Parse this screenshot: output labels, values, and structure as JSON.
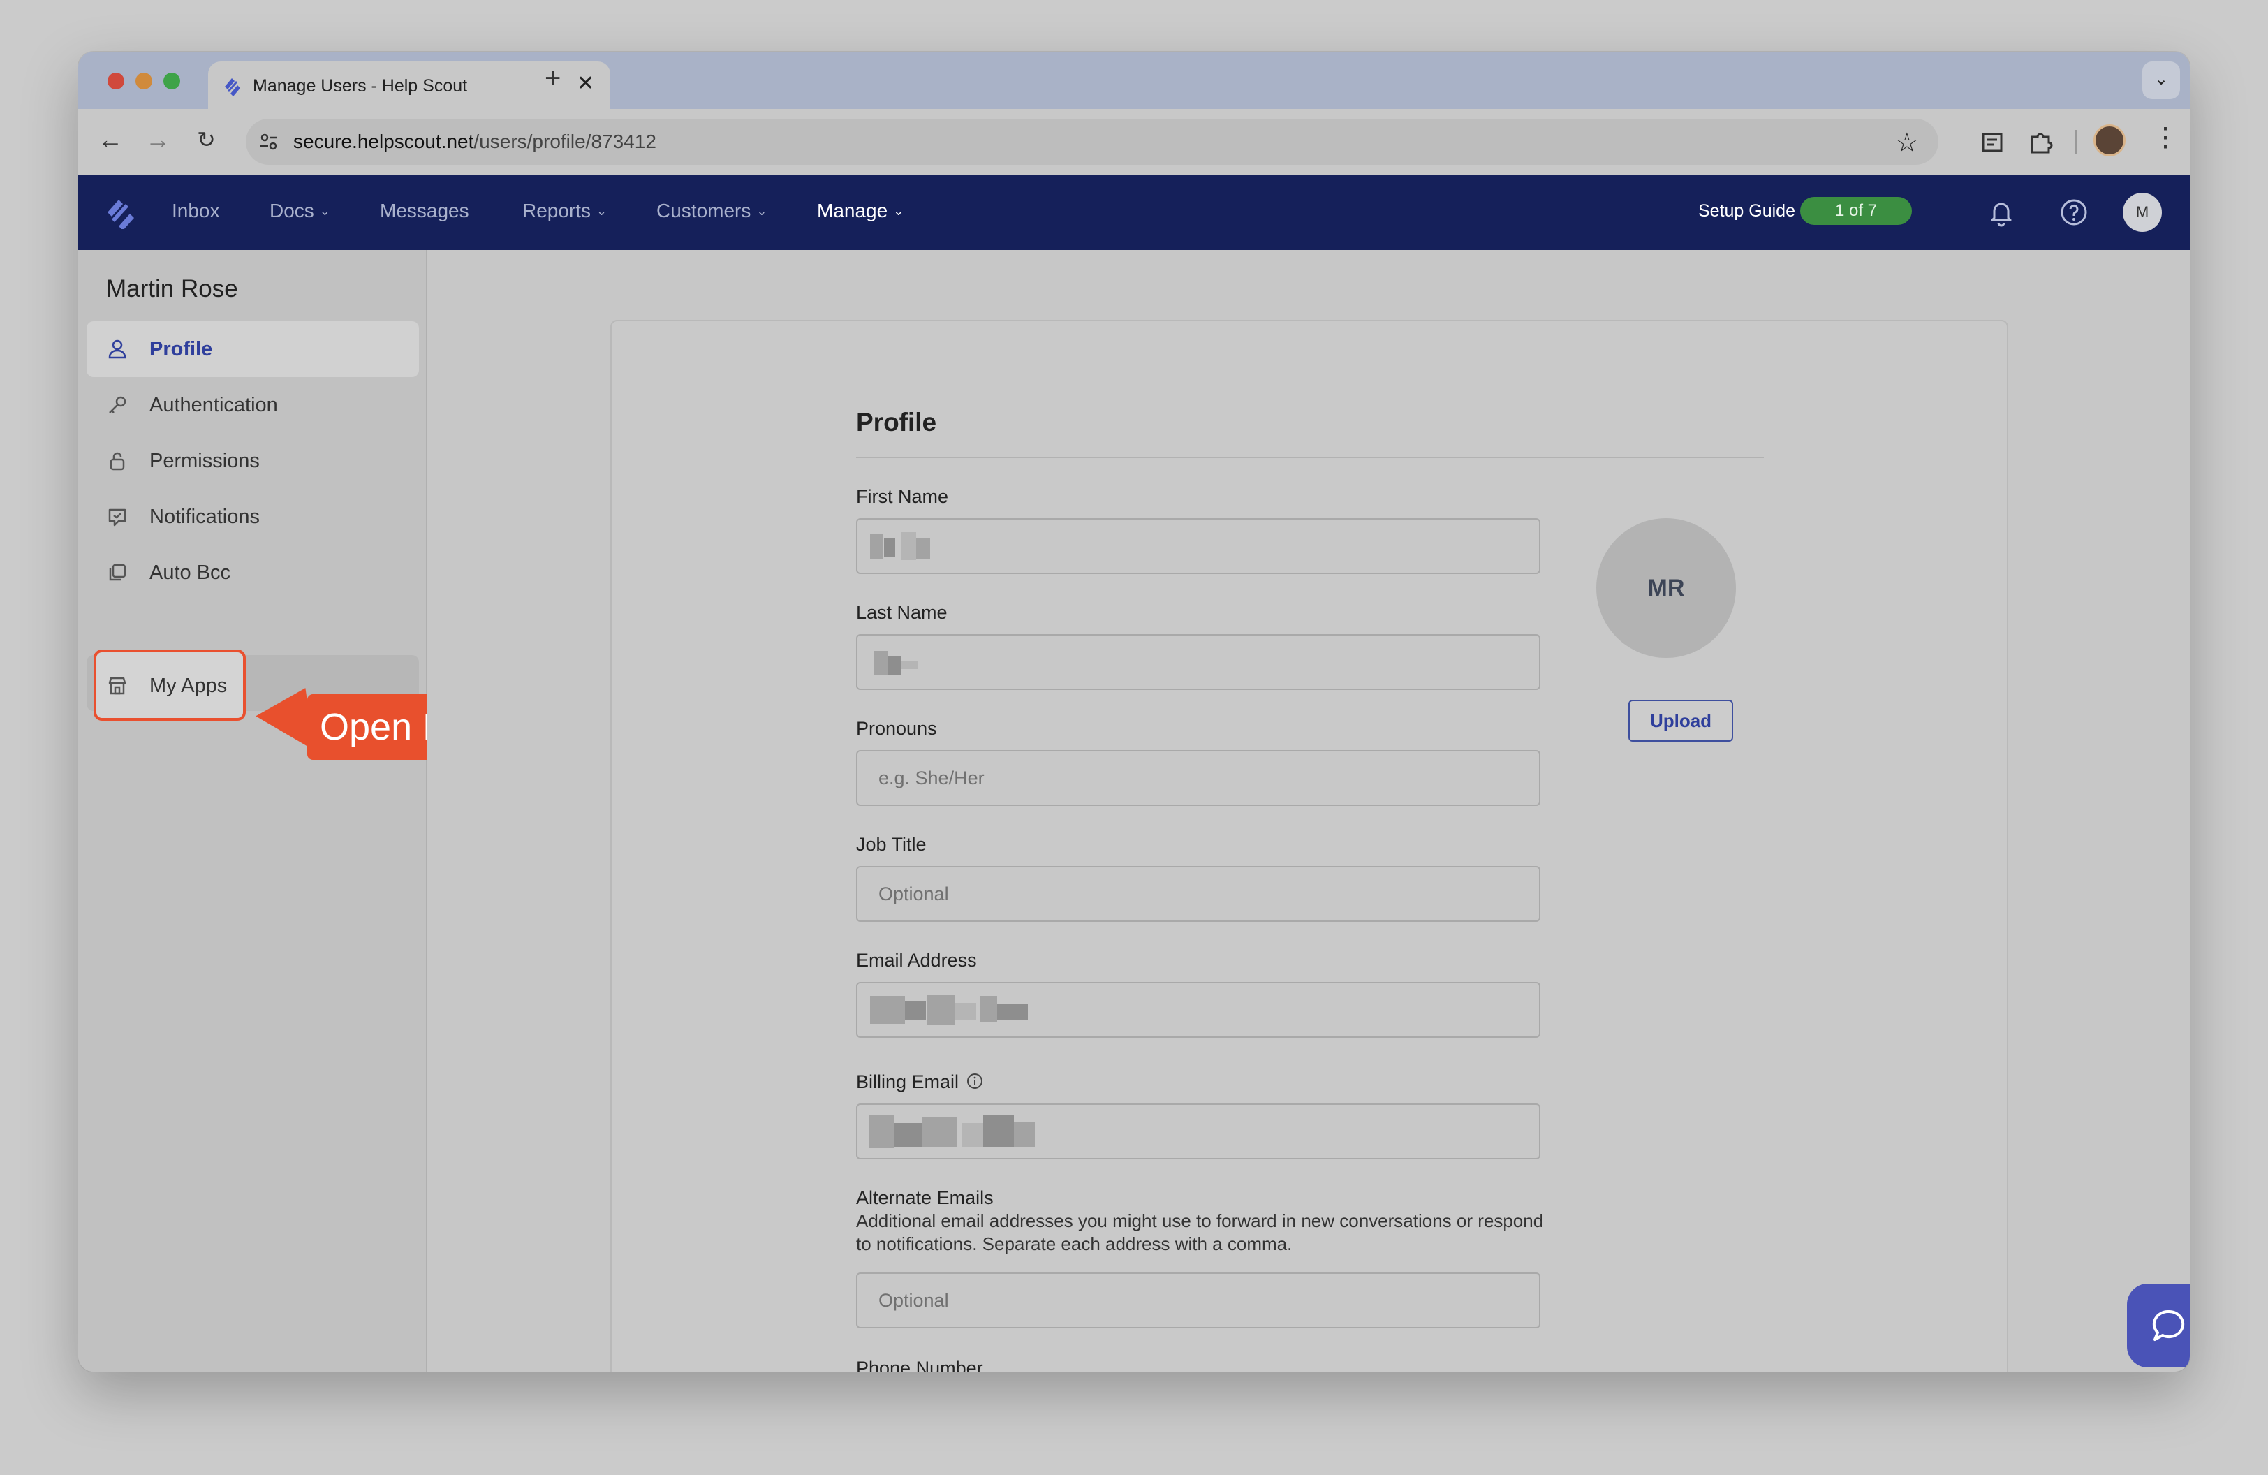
{
  "browser": {
    "tab_title": "Manage Users - Help Scout",
    "new_tab_label": "+",
    "url_host": "secure.helpscout.net",
    "url_path": "/users/profile/873412"
  },
  "app_nav": {
    "items": [
      {
        "label": "Inbox",
        "dropdown": false,
        "active": false
      },
      {
        "label": "Docs",
        "dropdown": true,
        "active": false
      },
      {
        "label": "Messages",
        "dropdown": false,
        "active": false
      },
      {
        "label": "Reports",
        "dropdown": true,
        "active": false
      },
      {
        "label": "Customers",
        "dropdown": true,
        "active": false
      },
      {
        "label": "Manage",
        "dropdown": true,
        "active": true
      }
    ],
    "setup_guide_label": "Setup Guide",
    "setup_guide_progress": "1 of 7",
    "avatar_initial": "M"
  },
  "sidebar": {
    "user_name": "Martin Rose",
    "items": [
      {
        "label": "Profile",
        "icon": "user-icon",
        "active": true
      },
      {
        "label": "Authentication",
        "icon": "key-icon",
        "active": false
      },
      {
        "label": "Permissions",
        "icon": "lock-icon",
        "active": false
      },
      {
        "label": "Notifications",
        "icon": "notification-icon",
        "active": false
      },
      {
        "label": "Auto Bcc",
        "icon": "copy-icon",
        "active": false
      },
      {
        "label": "My Apps",
        "icon": "store-icon",
        "active": false
      }
    ]
  },
  "callout": {
    "text": "Open My Apps"
  },
  "profile_form": {
    "title": "Profile",
    "first_name_label": "First Name",
    "last_name_label": "Last Name",
    "pronouns_label": "Pronouns",
    "pronouns_placeholder": "e.g. She/Her",
    "job_title_label": "Job Title",
    "job_title_placeholder": "Optional",
    "email_label": "Email Address",
    "billing_email_label": "Billing Email",
    "alternate_emails_label": "Alternate Emails",
    "alternate_emails_help": "Additional email addresses you might use to forward in new conversations or respond to notifications. Separate each address with a comma.",
    "alternate_emails_placeholder": "Optional",
    "phone_label": "Phone Number",
    "avatar_initials": "MR",
    "upload_label": "Upload"
  },
  "colors": {
    "app_nav_bg": "#15205a",
    "accent": "#2f3f9c",
    "setup_badge": "#3b8e41",
    "callout": "#e8502d",
    "chat_button": "#4a53b7"
  }
}
